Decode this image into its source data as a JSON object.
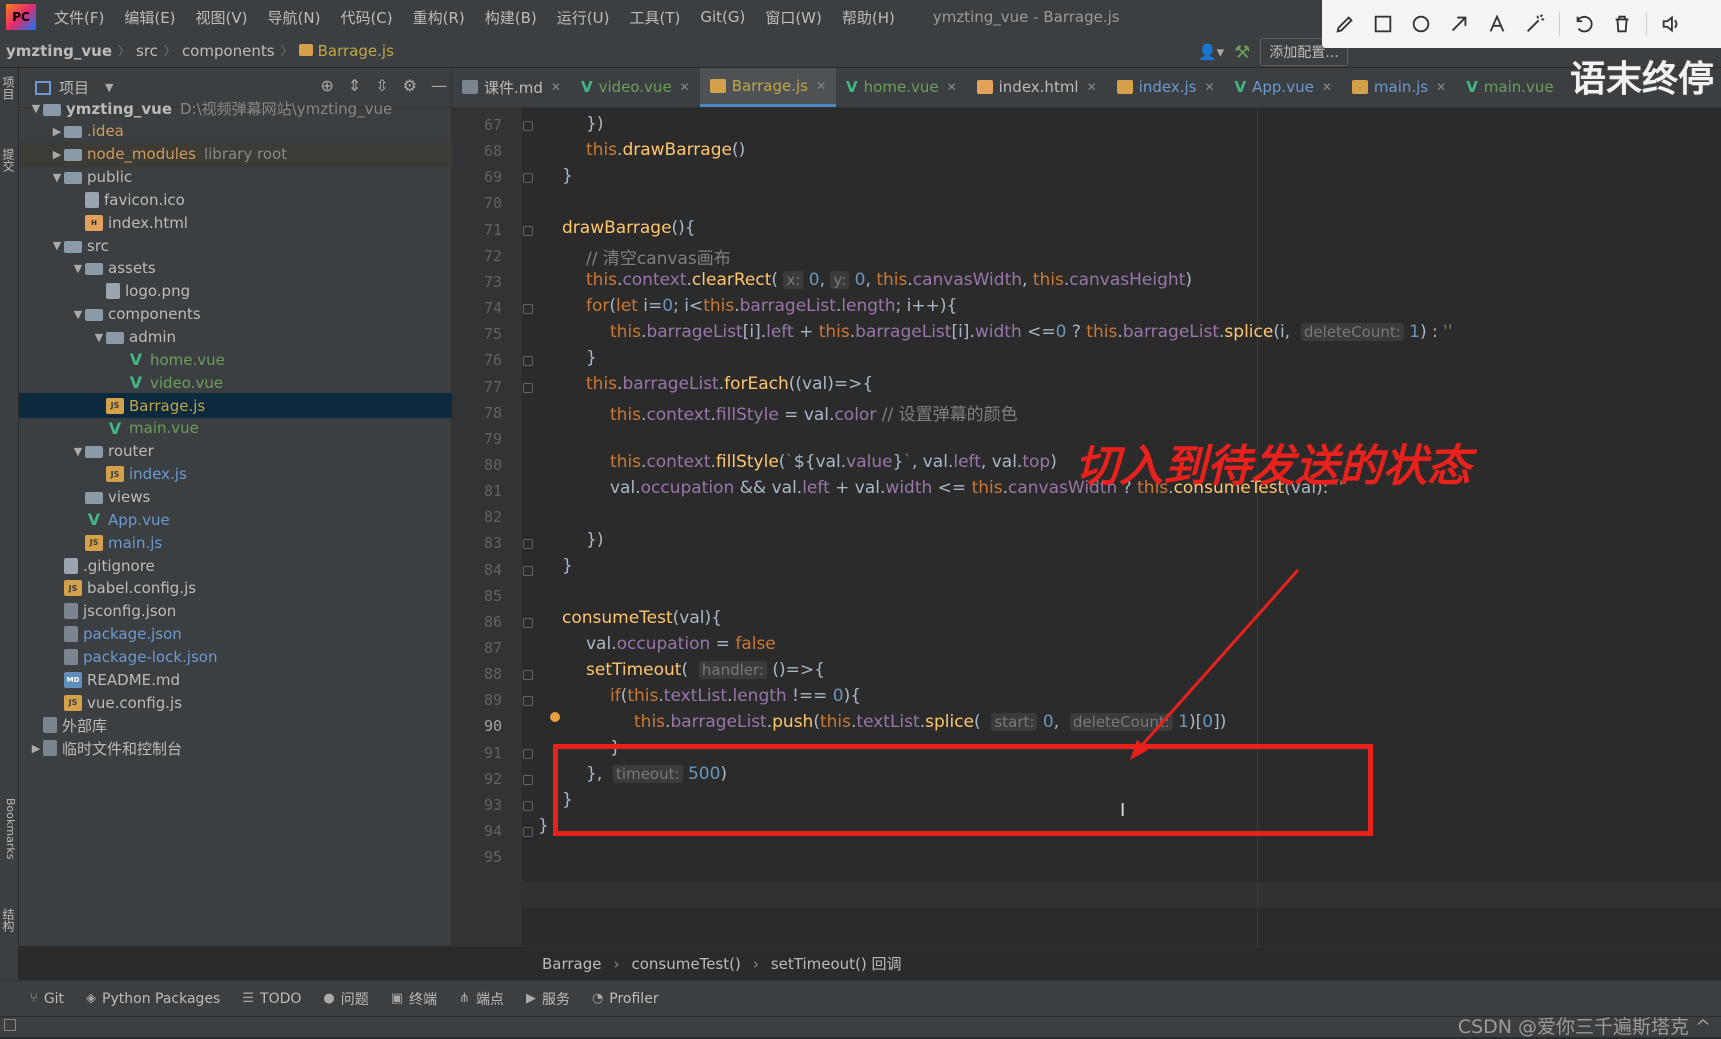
{
  "menubar": {
    "items": [
      "文件(F)",
      "编辑(E)",
      "视图(V)",
      "导航(N)",
      "代码(C)",
      "重构(R)",
      "构建(B)",
      "运行(U)",
      "工具(T)",
      "Git(G)",
      "窗口(W)",
      "帮助(H)"
    ],
    "window_title": "ymzting_vue - Barrage.js"
  },
  "annotation_toolbar": {
    "tools": [
      "pencil-icon",
      "rectangle-icon",
      "circle-icon",
      "arrow-icon",
      "text-icon",
      "magic-wand-icon",
      "undo-icon",
      "trash-icon",
      "volume-icon"
    ]
  },
  "navbar": {
    "crumbs": [
      "ymzting_vue",
      "src",
      "components",
      "Barrage.js"
    ],
    "add_config": "添加配置..."
  },
  "left_stripe": {
    "project": "项目",
    "commit": "提交",
    "bookmarks": "Bookmarks",
    "structure": "结构"
  },
  "project_panel": {
    "title": "项目",
    "tree": [
      {
        "label": "ymzting_vue",
        "extra": "D:\\视频弹幕网站\\ymzting_vue"
      },
      {
        "label": ".idea"
      },
      {
        "label": "node_modules",
        "extra": "library root"
      },
      {
        "label": "public"
      },
      {
        "label": "favicon.ico"
      },
      {
        "label": "index.html"
      },
      {
        "label": "src"
      },
      {
        "label": "assets"
      },
      {
        "label": "logo.png"
      },
      {
        "label": "components"
      },
      {
        "label": "admin"
      },
      {
        "label": "home.vue"
      },
      {
        "label": "video.vue"
      },
      {
        "label": "Barrage.js"
      },
      {
        "label": "main.vue"
      },
      {
        "label": "router"
      },
      {
        "label": "index.js"
      },
      {
        "label": "views"
      },
      {
        "label": "App.vue"
      },
      {
        "label": "main.js"
      },
      {
        "label": ".gitignore"
      },
      {
        "label": "babel.config.js"
      },
      {
        "label": "jsconfig.json"
      },
      {
        "label": "package.json"
      },
      {
        "label": "package-lock.json"
      },
      {
        "label": "README.md"
      },
      {
        "label": "vue.config.js"
      },
      {
        "label": "外部库"
      },
      {
        "label": "临时文件和控制台"
      }
    ]
  },
  "tabs": [
    "课件.md",
    "video.vue",
    "Barrage.js",
    "home.vue",
    "index.html",
    "index.js",
    "App.vue",
    "main.js",
    "main.vue"
  ],
  "watermark": "语末终停",
  "editor": {
    "line_numbers": [
      "67",
      "68",
      "69",
      "70",
      "71",
      "72",
      "73",
      "74",
      "75",
      "76",
      "77",
      "78",
      "79",
      "80",
      "81",
      "82",
      "83",
      "84",
      "85",
      "86",
      "87",
      "88",
      "89",
      "90",
      "91",
      "92",
      "93",
      "94",
      "95"
    ],
    "current_line": 90
  },
  "annotation_text": "切入到待发送的状态",
  "breadcrumb": [
    "Barrage",
    "consumeTest()",
    "setTimeout() 回调"
  ],
  "tool_windows": [
    "Git",
    "Python Packages",
    "TODO",
    "问题",
    "终端",
    "端点",
    "服务",
    "Profiler"
  ],
  "status": {
    "csdn": "CSDN @爱你三千遍斯塔克 ^"
  },
  "colors": {
    "annotation_red": "#e8211d",
    "keyword": "#cc7832",
    "function": "#ffc66d",
    "property": "#9876aa",
    "number": "#6897bb"
  }
}
